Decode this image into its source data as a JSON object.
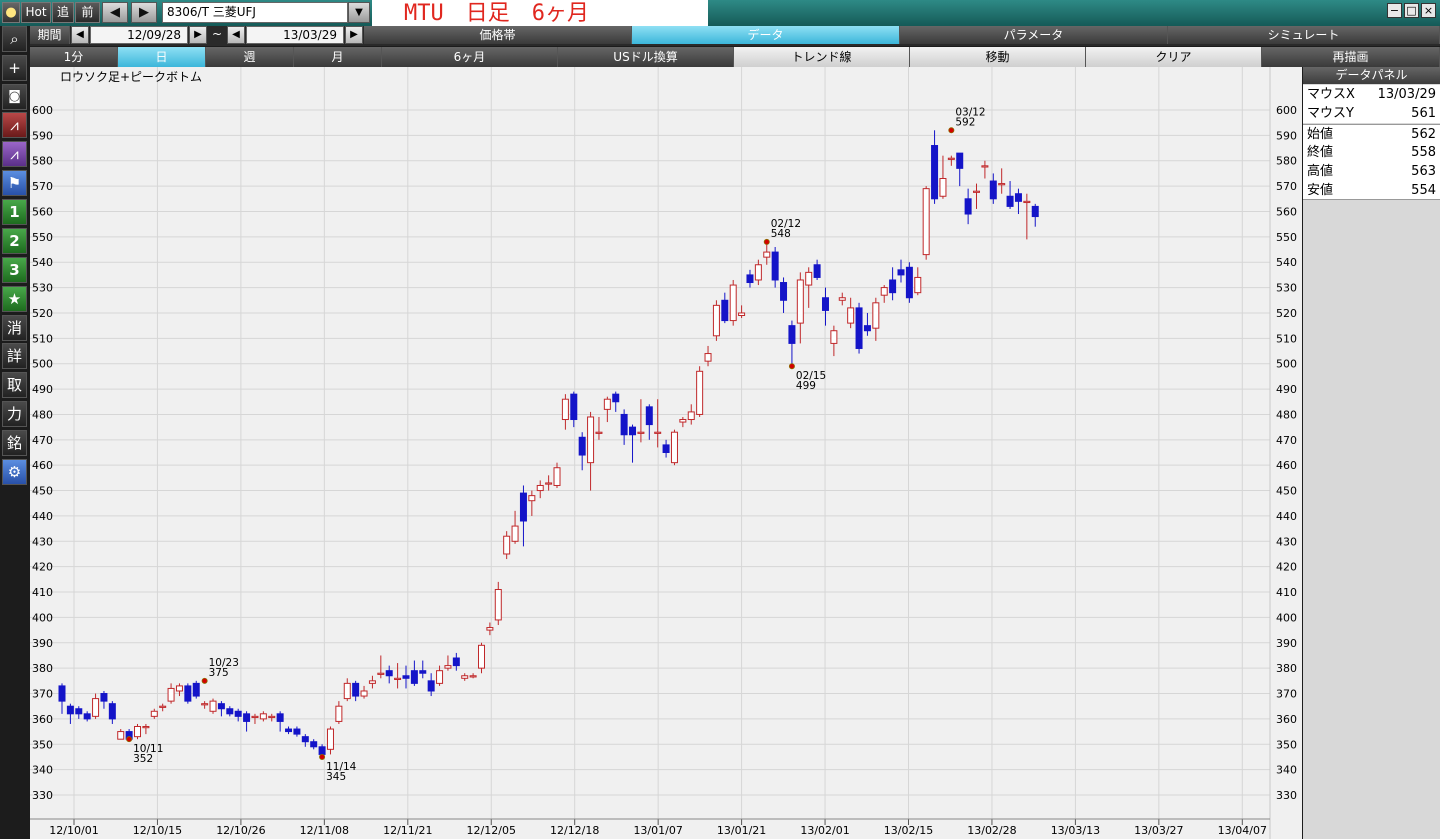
{
  "toolbar": {
    "hot_label": "Hot",
    "add_label": "追",
    "prev_label": "前",
    "back_arrow": "◀",
    "fwd_arrow": "▶",
    "code_value": "8306/T 三菱UFJ",
    "title_text": "MTU　日足　6ヶ月",
    "win_min": "−",
    "win_max": "□",
    "win_close": "×"
  },
  "period": {
    "label": "期間",
    "from": "12/09/28",
    "tilde": "~",
    "to": "13/03/29"
  },
  "main_tabs": [
    "価格帯",
    "データ",
    "パラメータ",
    "シミュレート"
  ],
  "timeframes": [
    "1分",
    "日",
    "週",
    "月"
  ],
  "tools": [
    "6ヶ月",
    "USドル換算",
    "トレンド線",
    "移動",
    "クリア",
    "再描画"
  ],
  "sidebar": {
    "labels": [
      "1",
      "2",
      "3",
      "★",
      "消",
      "詳",
      "取",
      "力",
      "銘"
    ]
  },
  "panel": {
    "title": "データパネル",
    "rows": [
      {
        "k": "マウスX",
        "v": "13/03/29"
      },
      {
        "k": "マウスY",
        "v": "561"
      },
      {
        "k": "始値",
        "v": "562"
      },
      {
        "k": "終値",
        "v": "558"
      },
      {
        "k": "高値",
        "v": "563"
      },
      {
        "k": "安値",
        "v": "554"
      }
    ]
  },
  "chart_data": {
    "type": "candlestick",
    "title": "ロウソク足+ピークボトム",
    "ylim": [
      330,
      600
    ],
    "yticks": [
      330,
      340,
      350,
      360,
      370,
      380,
      390,
      400,
      410,
      420,
      430,
      440,
      450,
      460,
      470,
      480,
      490,
      500,
      510,
      520,
      530,
      540,
      550,
      560,
      570,
      580,
      590,
      600
    ],
    "xticks": [
      "12/10/01",
      "12/10/15",
      "12/10/26",
      "12/11/08",
      "12/11/21",
      "12/12/05",
      "12/12/18",
      "13/01/07",
      "13/01/21",
      "13/02/01",
      "13/02/15",
      "13/02/28",
      "13/03/13",
      "13/03/27",
      "13/04/07"
    ],
    "colors": {
      "up": "#c0282a",
      "down": "#1414c8",
      "peak": "#d40000"
    },
    "candles": [
      {
        "o": 373,
        "c": 367,
        "h": 374,
        "l": 362
      },
      {
        "o": 365,
        "c": 362,
        "h": 366,
        "l": 358
      },
      {
        "o": 364,
        "c": 362,
        "h": 365,
        "l": 360
      },
      {
        "o": 362,
        "c": 360,
        "h": 363,
        "l": 359
      },
      {
        "o": 361,
        "c": 368,
        "h": 370,
        "l": 360
      },
      {
        "o": 370,
        "c": 367,
        "h": 371,
        "l": 364
      },
      {
        "o": 366,
        "c": 360,
        "h": 367,
        "l": 358
      },
      {
        "o": 352,
        "c": 355,
        "h": 356,
        "l": 352
      },
      {
        "o": 355,
        "c": 352,
        "h": 356,
        "l": 352
      },
      {
        "o": 353,
        "c": 357,
        "h": 358,
        "l": 352
      },
      {
        "o": 357,
        "c": 357,
        "h": 358,
        "l": 354
      },
      {
        "o": 361,
        "c": 363,
        "h": 364,
        "l": 360
      },
      {
        "o": 365,
        "c": 365,
        "h": 366,
        "l": 363
      },
      {
        "o": 367,
        "c": 372,
        "h": 374,
        "l": 366
      },
      {
        "o": 371,
        "c": 373,
        "h": 374,
        "l": 369
      },
      {
        "o": 373,
        "c": 367,
        "h": 374,
        "l": 366
      },
      {
        "o": 374,
        "c": 369,
        "h": 375,
        "l": 368
      },
      {
        "o": 366,
        "c": 366,
        "h": 367,
        "l": 364
      },
      {
        "o": 363,
        "c": 367,
        "h": 368,
        "l": 362
      },
      {
        "o": 366,
        "c": 364,
        "h": 367,
        "l": 361
      },
      {
        "o": 364,
        "c": 362,
        "h": 365,
        "l": 361
      },
      {
        "o": 363,
        "c": 361,
        "h": 364,
        "l": 359
      },
      {
        "o": 362,
        "c": 359,
        "h": 363,
        "l": 355
      },
      {
        "o": 361,
        "c": 361,
        "h": 362,
        "l": 358
      },
      {
        "o": 360,
        "c": 362,
        "h": 363,
        "l": 359
      },
      {
        "o": 361,
        "c": 361,
        "h": 362,
        "l": 359
      },
      {
        "o": 362,
        "c": 359,
        "h": 363,
        "l": 355
      },
      {
        "o": 356,
        "c": 355,
        "h": 357,
        "l": 354
      },
      {
        "o": 356,
        "c": 354,
        "h": 357,
        "l": 353
      },
      {
        "o": 353,
        "c": 351,
        "h": 354,
        "l": 349
      },
      {
        "o": 351,
        "c": 349,
        "h": 352,
        "l": 348
      },
      {
        "o": 349,
        "c": 346,
        "h": 350,
        "l": 345
      },
      {
        "o": 348,
        "c": 356,
        "h": 357,
        "l": 346
      },
      {
        "o": 359,
        "c": 365,
        "h": 367,
        "l": 358
      },
      {
        "o": 368,
        "c": 374,
        "h": 376,
        "l": 367
      },
      {
        "o": 374,
        "c": 369,
        "h": 375,
        "l": 367
      },
      {
        "o": 369,
        "c": 371,
        "h": 373,
        "l": 368
      },
      {
        "o": 374,
        "c": 375,
        "h": 377,
        "l": 372
      },
      {
        "o": 378,
        "c": 378,
        "h": 385,
        "l": 376
      },
      {
        "o": 379,
        "c": 377,
        "h": 381,
        "l": 374
      },
      {
        "o": 376,
        "c": 376,
        "h": 382,
        "l": 372
      },
      {
        "o": 377,
        "c": 376,
        "h": 381,
        "l": 372
      },
      {
        "o": 379,
        "c": 374,
        "h": 383,
        "l": 373
      },
      {
        "o": 379,
        "c": 378,
        "h": 383,
        "l": 376
      },
      {
        "o": 375,
        "c": 371,
        "h": 378,
        "l": 369
      },
      {
        "o": 374,
        "c": 379,
        "h": 381,
        "l": 373
      },
      {
        "o": 380,
        "c": 381,
        "h": 385,
        "l": 379
      },
      {
        "o": 384,
        "c": 381,
        "h": 386,
        "l": 379
      },
      {
        "o": 376,
        "c": 377,
        "h": 378,
        "l": 375
      },
      {
        "o": 377,
        "c": 377,
        "h": 378,
        "l": 376
      },
      {
        "o": 380,
        "c": 389,
        "h": 390,
        "l": 378
      },
      {
        "o": 395,
        "c": 396,
        "h": 398,
        "l": 393
      },
      {
        "o": 399,
        "c": 411,
        "h": 414,
        "l": 397
      },
      {
        "o": 425,
        "c": 432,
        "h": 434,
        "l": 423
      },
      {
        "o": 430,
        "c": 436,
        "h": 442,
        "l": 429
      },
      {
        "o": 449,
        "c": 438,
        "h": 452,
        "l": 428
      },
      {
        "o": 446,
        "c": 448,
        "h": 450,
        "l": 440
      },
      {
        "o": 450,
        "c": 452,
        "h": 454,
        "l": 447
      },
      {
        "o": 453,
        "c": 453,
        "h": 456,
        "l": 450
      },
      {
        "o": 452,
        "c": 459,
        "h": 461,
        "l": 451
      },
      {
        "o": 478,
        "c": 486,
        "h": 488,
        "l": 474
      },
      {
        "o": 488,
        "c": 478,
        "h": 489,
        "l": 475
      },
      {
        "o": 471,
        "c": 464,
        "h": 473,
        "l": 458
      },
      {
        "o": 461,
        "c": 479,
        "h": 481,
        "l": 450
      },
      {
        "o": 473,
        "c": 473,
        "h": 479,
        "l": 470
      },
      {
        "o": 482,
        "c": 486,
        "h": 487,
        "l": 477
      },
      {
        "o": 488,
        "c": 485,
        "h": 489,
        "l": 481
      },
      {
        "o": 480,
        "c": 472,
        "h": 482,
        "l": 468
      },
      {
        "o": 475,
        "c": 472,
        "h": 476,
        "l": 461
      },
      {
        "o": 473,
        "c": 473,
        "h": 486,
        "l": 469
      },
      {
        "o": 483,
        "c": 476,
        "h": 484,
        "l": 470
      },
      {
        "o": 473,
        "c": 473,
        "h": 486,
        "l": 467
      },
      {
        "o": 468,
        "c": 465,
        "h": 470,
        "l": 463
      },
      {
        "o": 461,
        "c": 473,
        "h": 474,
        "l": 460
      },
      {
        "o": 477,
        "c": 478,
        "h": 479,
        "l": 475
      },
      {
        "o": 478,
        "c": 481,
        "h": 484,
        "l": 476
      },
      {
        "o": 480,
        "c": 497,
        "h": 499,
        "l": 479
      },
      {
        "o": 501,
        "c": 504,
        "h": 507,
        "l": 499
      },
      {
        "o": 511,
        "c": 523,
        "h": 525,
        "l": 509
      },
      {
        "o": 525,
        "c": 517,
        "h": 528,
        "l": 516
      },
      {
        "o": 517,
        "c": 531,
        "h": 533,
        "l": 515
      },
      {
        "o": 519,
        "c": 520,
        "h": 523,
        "l": 518
      },
      {
        "o": 535,
        "c": 532,
        "h": 537,
        "l": 530
      },
      {
        "o": 533,
        "c": 539,
        "h": 541,
        "l": 531
      },
      {
        "o": 542,
        "c": 544,
        "h": 548,
        "l": 539
      },
      {
        "o": 544,
        "c": 533,
        "h": 546,
        "l": 530
      },
      {
        "o": 532,
        "c": 525,
        "h": 534,
        "l": 520
      },
      {
        "o": 515,
        "c": 508,
        "h": 517,
        "l": 500
      },
      {
        "o": 516,
        "c": 533,
        "h": 536,
        "l": 508
      },
      {
        "o": 531,
        "c": 536,
        "h": 538,
        "l": 522
      },
      {
        "o": 539,
        "c": 534,
        "h": 541,
        "l": 533
      },
      {
        "o": 526,
        "c": 521,
        "h": 530,
        "l": 515
      },
      {
        "o": 508,
        "c": 513,
        "h": 515,
        "l": 503
      },
      {
        "o": 525,
        "c": 526,
        "h": 528,
        "l": 523
      },
      {
        "o": 516,
        "c": 522,
        "h": 526,
        "l": 514
      },
      {
        "o": 522,
        "c": 506,
        "h": 524,
        "l": 504
      },
      {
        "o": 515,
        "c": 513,
        "h": 520,
        "l": 511
      },
      {
        "o": 514,
        "c": 524,
        "h": 526,
        "l": 509
      },
      {
        "o": 527,
        "c": 530,
        "h": 531,
        "l": 524
      },
      {
        "o": 533,
        "c": 528,
        "h": 538,
        "l": 525
      },
      {
        "o": 537,
        "c": 535,
        "h": 541,
        "l": 532
      },
      {
        "o": 538,
        "c": 526,
        "h": 540,
        "l": 524
      },
      {
        "o": 528,
        "c": 534,
        "h": 538,
        "l": 527
      },
      {
        "o": 543,
        "c": 569,
        "h": 570,
        "l": 541
      },
      {
        "o": 586,
        "c": 565,
        "h": 592,
        "l": 563
      },
      {
        "o": 566,
        "c": 573,
        "h": 582,
        "l": 565
      },
      {
        "o": 581,
        "c": 581,
        "h": 582,
        "l": 578
      },
      {
        "o": 583,
        "c": 577,
        "h": 583,
        "l": 570
      },
      {
        "o": 565,
        "c": 559,
        "h": 569,
        "l": 555
      },
      {
        "o": 568,
        "c": 568,
        "h": 571,
        "l": 561
      },
      {
        "o": 578,
        "c": 578,
        "h": 580,
        "l": 573
      },
      {
        "o": 572,
        "c": 565,
        "h": 575,
        "l": 563
      },
      {
        "o": 571,
        "c": 571,
        "h": 577,
        "l": 567
      },
      {
        "o": 566,
        "c": 562,
        "h": 572,
        "l": 561
      },
      {
        "o": 567,
        "c": 564,
        "h": 569,
        "l": 559
      },
      {
        "o": 564,
        "c": 564,
        "h": 567,
        "l": 549
      },
      {
        "o": 562,
        "c": 558,
        "h": 563,
        "l": 554
      }
    ],
    "annotations": [
      {
        "i": 8,
        "price": 352,
        "date": "10/11",
        "val": "352",
        "pos": "below"
      },
      {
        "i": 17,
        "price": 375,
        "date": "10/23",
        "val": "375",
        "pos": "above"
      },
      {
        "i": 31,
        "price": 345,
        "date": "11/14",
        "val": "345",
        "pos": "below"
      },
      {
        "i": 84,
        "price": 548,
        "date": "02/12",
        "val": "548",
        "pos": "above"
      },
      {
        "i": 87,
        "price": 499,
        "date": "02/15",
        "val": "499",
        "pos": "below"
      },
      {
        "i": 106,
        "price": 592,
        "date": "03/12",
        "val": "592",
        "pos": "above"
      }
    ]
  }
}
